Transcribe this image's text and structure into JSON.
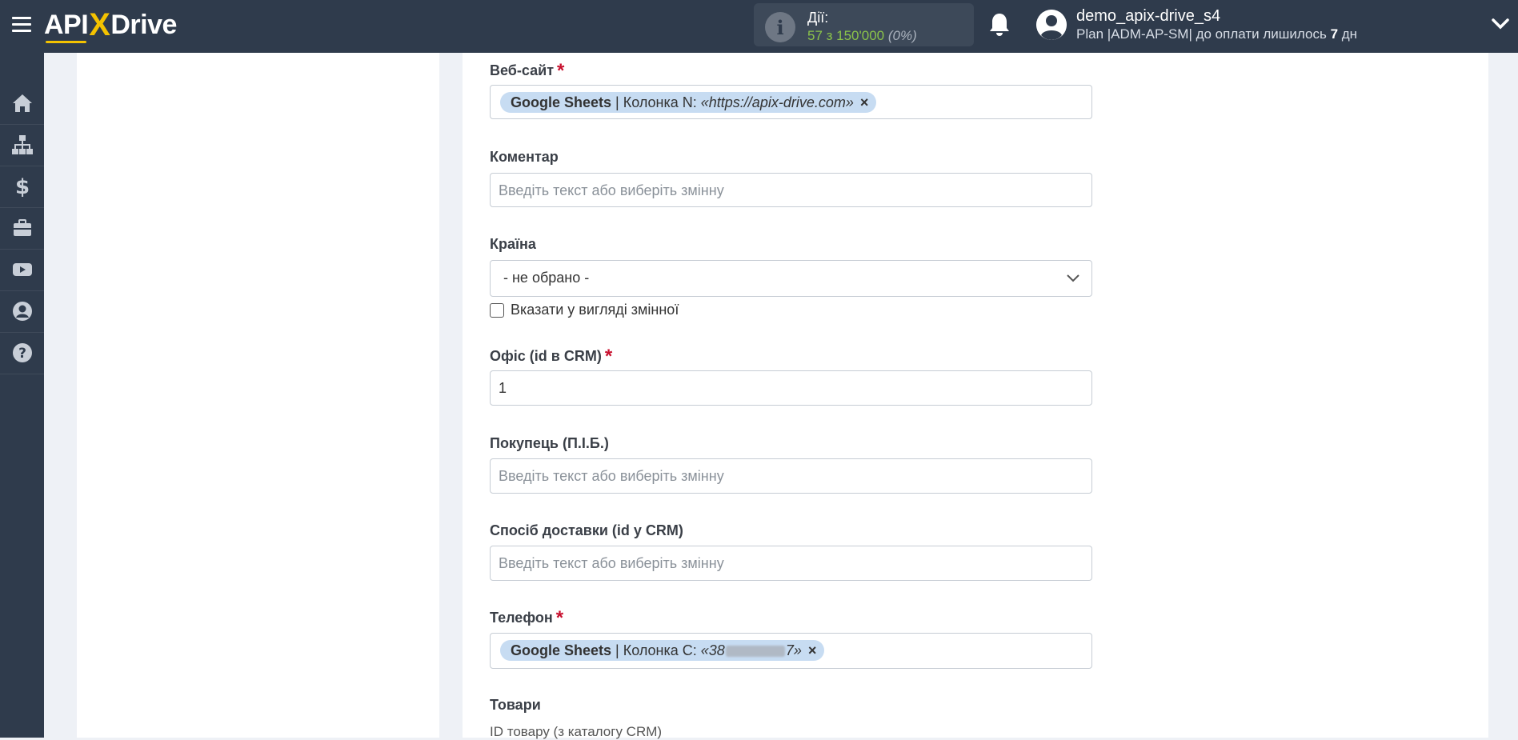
{
  "header": {
    "logo_left": "API",
    "logo_x": "X",
    "logo_right": "Drive",
    "actions_label": "Дії:",
    "actions_count": "57 з 150'000",
    "actions_pct": "(0%)",
    "user_name": "demo_apix-drive_s4",
    "plan_prefix": "Plan |ADM-AP-SM| до оплати лишилось",
    "plan_days": "7",
    "plan_suffix": "дн"
  },
  "sidebar": {
    "items": [
      {
        "icon": "home-icon"
      },
      {
        "icon": "sitemap-icon"
      },
      {
        "icon": "dollar-icon"
      },
      {
        "icon": "briefcase-icon"
      },
      {
        "icon": "youtube-icon"
      },
      {
        "icon": "user-circle-icon"
      },
      {
        "icon": "help-icon"
      }
    ]
  },
  "form": {
    "website": {
      "label": "Веб-сайт",
      "required": "*",
      "chip_source": "Google Sheets",
      "chip_sep": "|",
      "chip_column": "Колонка N:",
      "chip_value": "«https://apix-drive.com»",
      "chip_remove": "×"
    },
    "comment": {
      "label": "Коментар",
      "placeholder": "Введіть текст або виберіть змінну"
    },
    "country": {
      "label": "Країна",
      "selected": "- не обрано -",
      "checkbox_label": "Вказати у вигляді змінної"
    },
    "office": {
      "label": "Офіс (id в CRM)",
      "required": "*",
      "value": "1"
    },
    "buyer": {
      "label": "Покупець (П.І.Б.)",
      "placeholder": "Введіть текст або виберіть змінну"
    },
    "delivery": {
      "label": "Спосіб доставки (id у CRM)",
      "placeholder": "Введіть текст або виберіть змінну"
    },
    "phone": {
      "label": "Телефон",
      "required": "*",
      "chip_source": "Google Sheets",
      "chip_sep": "|",
      "chip_column": "Колонка C:",
      "chip_value_start": "«38",
      "chip_value_end": "7»",
      "chip_remove": "×"
    },
    "products": {
      "label": "Товари",
      "sub_label": "ID товару (з каталогу CRM)"
    }
  }
}
